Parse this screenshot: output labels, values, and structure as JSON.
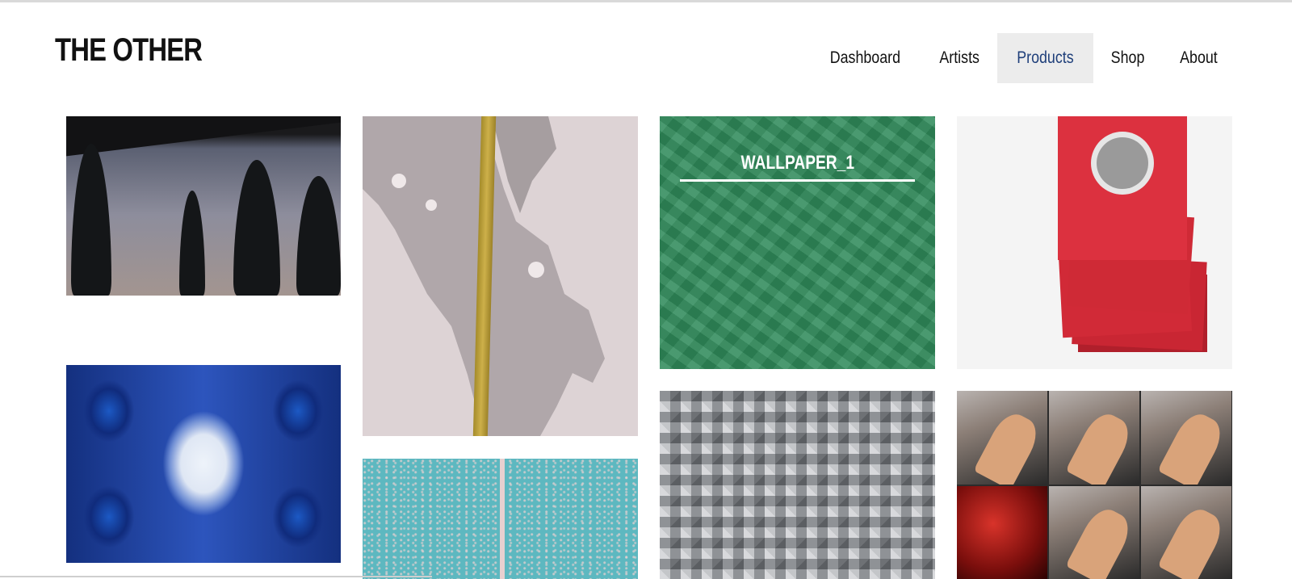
{
  "header": {
    "logo": "THE OTHER"
  },
  "nav": {
    "items": [
      {
        "label": "Dashboard",
        "active": false
      },
      {
        "label": "Artists",
        "active": false
      },
      {
        "label": "Products",
        "active": true
      },
      {
        "label": "Shop",
        "active": false
      },
      {
        "label": "About",
        "active": false
      }
    ]
  },
  "gallery": {
    "tiles": [
      {
        "image": "cypress-trees-dusk-photo"
      },
      {
        "image": "graphite-splash-gold-stripe-artwork"
      },
      {
        "image": "green-geometric-wallpaper",
        "caption": "WALLPAPER_1"
      },
      {
        "image": "red-wrapped-books-stack"
      },
      {
        "image": "blue-kaleidoscope-pattern"
      },
      {
        "image": "turquoise-speckled-texture"
      },
      {
        "image": "silver-crystal-shards"
      },
      {
        "image": "hand-gesture-photo-grid"
      }
    ]
  },
  "colors": {
    "active_nav_bg": "#ececec",
    "active_nav_text": "#1f3f7a",
    "wallpaper_green": "#2f8a5a"
  }
}
